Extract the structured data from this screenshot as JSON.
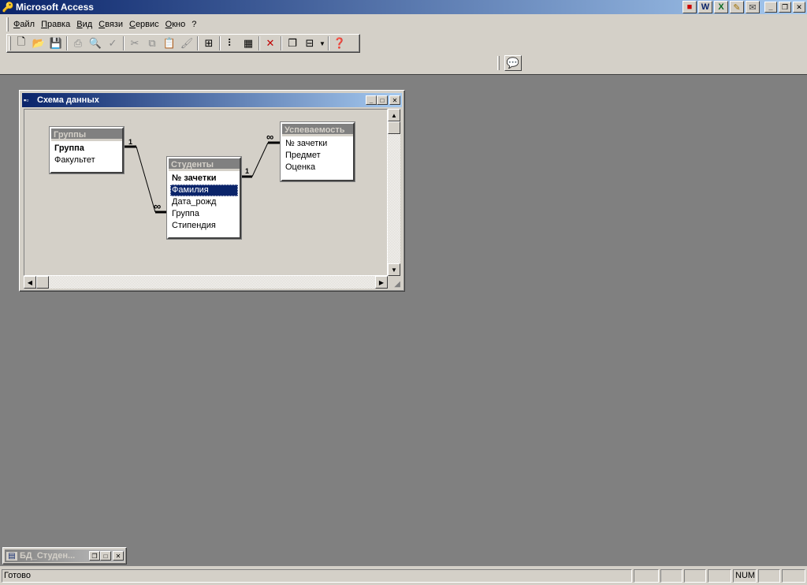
{
  "app": {
    "title": "Microsoft Access",
    "quick_launch": [
      "W",
      "X",
      "✎",
      "✉"
    ]
  },
  "menu": [
    "Файл",
    "Правка",
    "Вид",
    "Связи",
    "Сервис",
    "Окно",
    "?"
  ],
  "relationships_window": {
    "title": "Схема данных",
    "tables": [
      {
        "id": "gruppy",
        "title": "Группы",
        "fields": [
          {
            "name": "Группа",
            "key": true
          },
          {
            "name": "Факультет"
          }
        ]
      },
      {
        "id": "studenty",
        "title": "Студенты",
        "fields": [
          {
            "name": "№ зачетки",
            "key": true
          },
          {
            "name": "Фамилия",
            "selected": true
          },
          {
            "name": "Дата_рожд"
          },
          {
            "name": "Группа"
          },
          {
            "name": "Стипендия"
          }
        ]
      },
      {
        "id": "uspevaemost",
        "title": "Успеваемость",
        "fields": [
          {
            "name": "№ зачетки"
          },
          {
            "name": "Предмет"
          },
          {
            "name": "Оценка"
          }
        ]
      }
    ],
    "relations": [
      {
        "from": "Группы",
        "to": "Студенты",
        "one": "1",
        "many": "∞"
      },
      {
        "from": "Студенты",
        "to": "Успеваемость",
        "one": "1",
        "many": "∞"
      }
    ]
  },
  "db_window": {
    "title": "БД_Студен..."
  },
  "status": {
    "text": "Готово",
    "num": "NUM"
  }
}
